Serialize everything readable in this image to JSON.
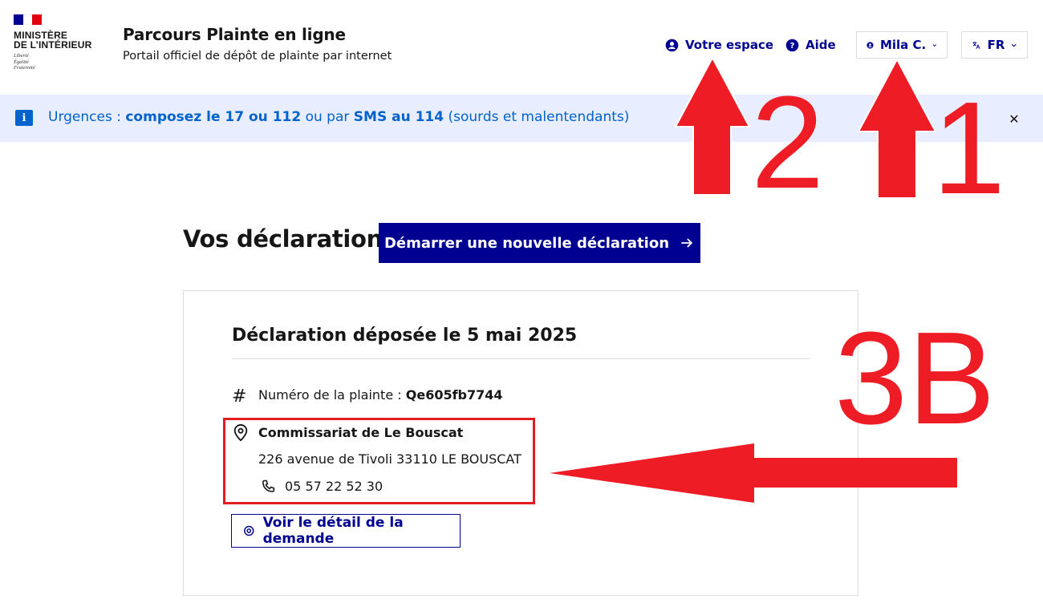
{
  "header": {
    "ministry_line1": "MINISTÈRE",
    "ministry_line2": "DE L’INTÉRIEUR",
    "motto": [
      "Liberté",
      "Égalité",
      "Fraternité"
    ],
    "service_title": "Parcours Plainte en ligne",
    "service_tagline": "Portail officiel de dépôt de plainte par internet",
    "tools": {
      "espace_label": "Votre espace",
      "aide_label": "Aide",
      "user_label": "Mila C.",
      "lang_label": "FR"
    }
  },
  "notice": {
    "prefix": "Urgences : ",
    "bold1": "composez le 17 ou 112",
    "mid": " ou par ",
    "bold2": "SMS au 114",
    "suffix": " (sourds et malentendants)",
    "close_symbol": "✕"
  },
  "main": {
    "title": "Vos déclarations",
    "new_declaration_label": "Démarrer une nouvelle déclaration",
    "card": {
      "title": "Déclaration déposée le 5 mai 2025",
      "complaint_number_label": "Numéro de la plainte : ",
      "complaint_number_value": "Qe605fb7744",
      "station_name": "Commissariat de Le Bouscat",
      "station_address": "226 avenue de Tivoli 33110 LE BOUSCAT",
      "station_phone": "05 57 22 52 30",
      "detail_button_label": "Voir le détail de la demande"
    }
  },
  "annotations": {
    "label_1": "1",
    "label_2": "2",
    "label_3b": "3B",
    "color": "#ee1c25"
  },
  "colors": {
    "primary_blue": "#000091",
    "info_blue": "#0063cb",
    "notice_bg": "#e8edff",
    "annotation_red": "#ee1c25"
  }
}
